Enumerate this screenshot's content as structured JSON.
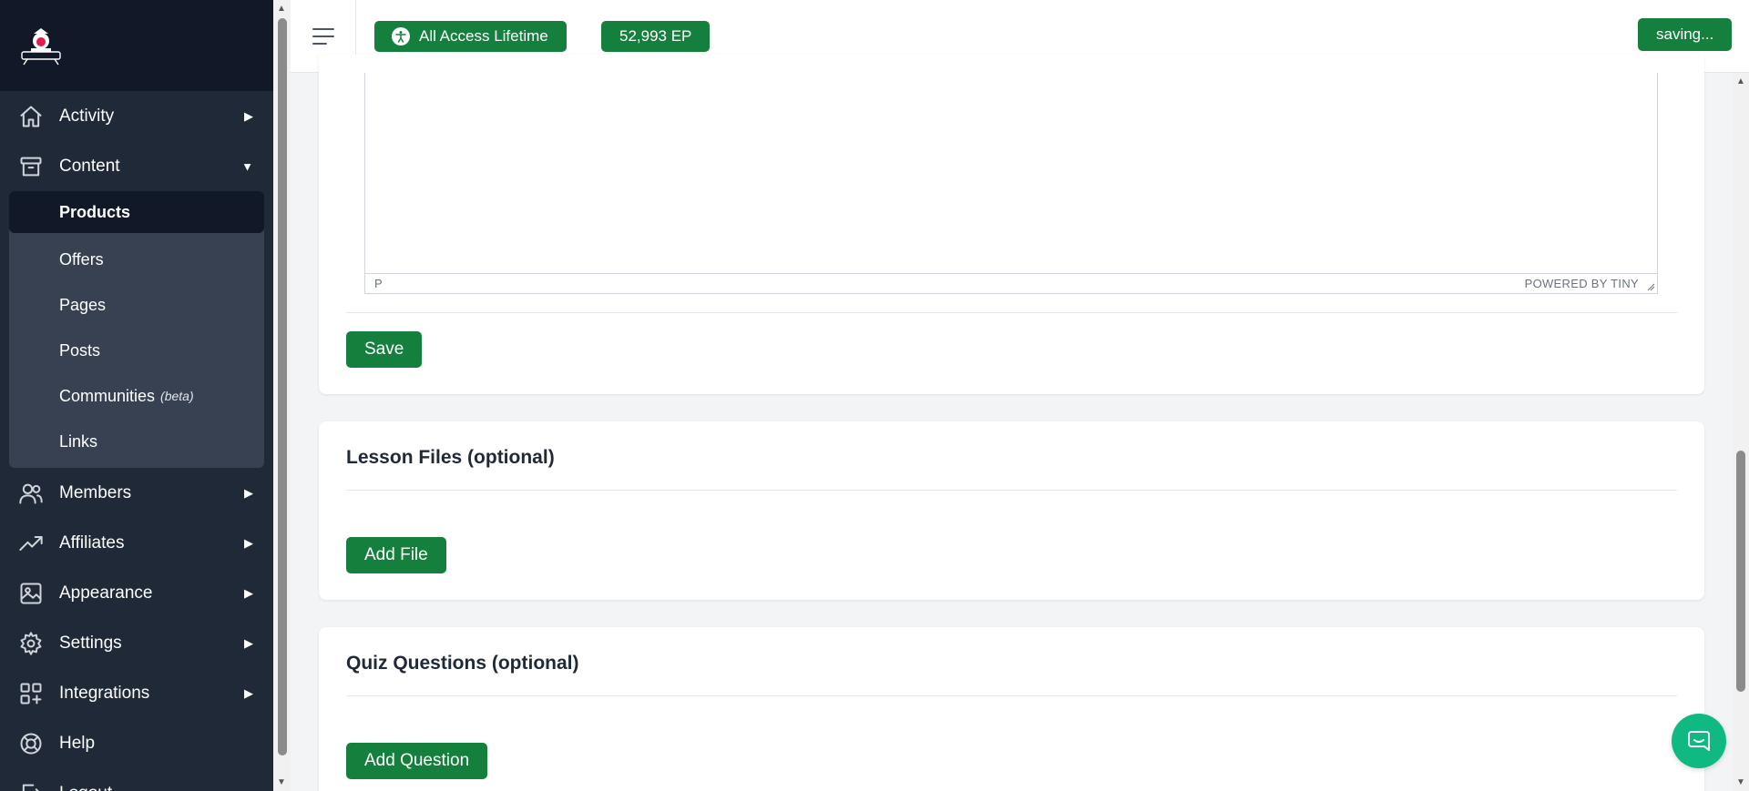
{
  "sidebar": {
    "nav": [
      {
        "label": "Activity",
        "icon": "home-icon"
      },
      {
        "label": "Content",
        "icon": "archive-icon"
      }
    ],
    "content_sub": [
      {
        "label": "Products",
        "active": true
      },
      {
        "label": "Offers"
      },
      {
        "label": "Pages"
      },
      {
        "label": "Posts"
      },
      {
        "label": "Communities",
        "badge": "(beta)"
      },
      {
        "label": "Links"
      }
    ],
    "nav_after": [
      {
        "label": "Members",
        "icon": "users-icon"
      },
      {
        "label": "Affiliates",
        "icon": "trending-up-icon"
      },
      {
        "label": "Appearance",
        "icon": "image-icon"
      },
      {
        "label": "Settings",
        "icon": "gear-icon"
      },
      {
        "label": "Integrations",
        "icon": "apps-plus-icon"
      },
      {
        "label": "Help",
        "icon": "lifebuoy-icon"
      },
      {
        "label": "Logout",
        "icon": "logout-icon"
      }
    ]
  },
  "topbar": {
    "access_label": "All Access Lifetime",
    "ep_label": "52,993 EP",
    "saving_label": "saving..."
  },
  "editor": {
    "path": "P",
    "powered_by": "POWERED BY TINY"
  },
  "cards": {
    "save_label": "Save",
    "lesson_files_title": "Lesson Files (optional)",
    "add_file_label": "Add File",
    "quiz_title": "Quiz Questions (optional)",
    "add_question_label": "Add Question"
  },
  "colors": {
    "sidebar_bg": "#1f2937",
    "accent_green": "#15803d",
    "chat_green": "#10b981"
  }
}
